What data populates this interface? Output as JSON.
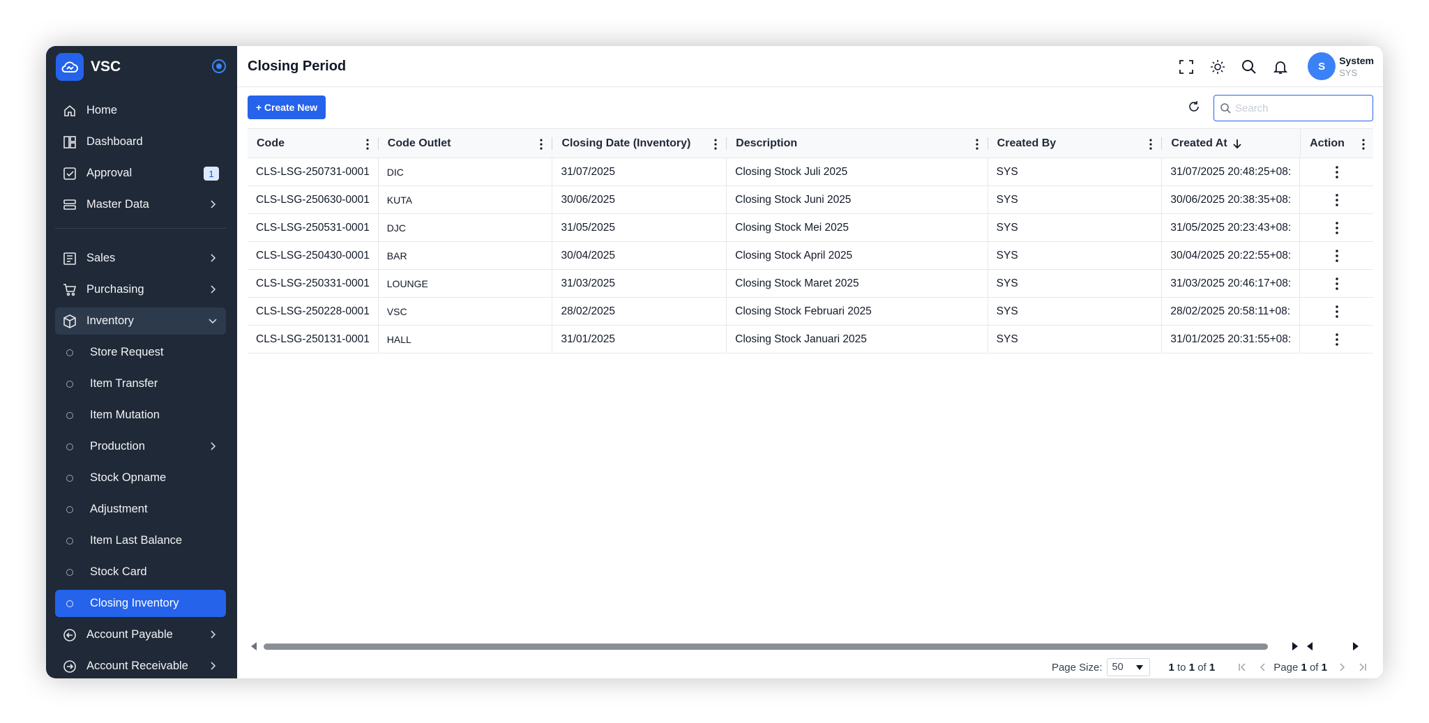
{
  "brand": {
    "name": "VSC"
  },
  "sidebar": {
    "items": [
      {
        "label": "Home",
        "icon": "home-icon"
      },
      {
        "label": "Dashboard",
        "icon": "dashboard-icon"
      },
      {
        "label": "Approval",
        "icon": "approval-icon",
        "badge": "1"
      },
      {
        "label": "Master Data",
        "icon": "database-icon"
      },
      {
        "label": "Sales",
        "icon": "sales-icon"
      },
      {
        "label": "Purchasing",
        "icon": "cart-icon"
      },
      {
        "label": "Inventory",
        "icon": "box-icon"
      },
      {
        "label": "Store Request"
      },
      {
        "label": "Item Transfer"
      },
      {
        "label": "Item Mutation"
      },
      {
        "label": "Production"
      },
      {
        "label": "Stock Opname"
      },
      {
        "label": "Adjustment"
      },
      {
        "label": "Item Last Balance"
      },
      {
        "label": "Stock Card"
      },
      {
        "label": "Closing Inventory"
      },
      {
        "label": "Account Payable",
        "icon": "arrow-left-circle-icon"
      },
      {
        "label": "Account Receivable",
        "icon": "arrow-right-circle-icon"
      }
    ]
  },
  "header": {
    "title": "Closing Period",
    "user": {
      "initial": "S",
      "name": "System",
      "code": "SYS"
    }
  },
  "toolbar": {
    "create_label": "+ Create New",
    "search_placeholder": "Search"
  },
  "table": {
    "columns": [
      "Code",
      "Code Outlet",
      "Closing Date (Inventory)",
      "Description",
      "Created By",
      "Created At",
      "Action"
    ],
    "rows": [
      [
        "CLS-LSG-250731-0001",
        "DIC",
        "31/07/2025",
        "Closing Stock Juli 2025",
        "SYS",
        "31/07/2025  20:48:25+08:"
      ],
      [
        "CLS-LSG-250630-0001",
        "KUTA",
        "30/06/2025",
        "Closing Stock Juni 2025",
        "SYS",
        "30/06/2025  20:38:35+08:"
      ],
      [
        "CLS-LSG-250531-0001",
        "DJC",
        "31/05/2025",
        "Closing Stock Mei 2025",
        "SYS",
        "31/05/2025  20:23:43+08:"
      ],
      [
        "CLS-LSG-250430-0001",
        "BAR",
        "30/04/2025",
        "Closing Stock April 2025",
        "SYS",
        "30/04/2025  20:22:55+08:"
      ],
      [
        "CLS-LSG-250331-0001",
        "LOUNGE",
        "31/03/2025",
        "Closing Stock Maret 2025",
        "SYS",
        "31/03/2025  20:46:17+08:"
      ],
      [
        "CLS-LSG-250228-0001",
        "VSC",
        "28/02/2025",
        "Closing Stock Februari 2025",
        "SYS",
        "28/02/2025  20:58:11+08:"
      ],
      [
        "CLS-LSG-250131-0001",
        "HALL",
        "31/01/2025",
        "Closing Stock Januari 2025",
        "SYS",
        "31/01/2025  20:31:55+08:"
      ]
    ]
  },
  "footer": {
    "page_size_label": "Page Size:",
    "page_size_value": "50",
    "range_from": "1",
    "range_to": "1",
    "range_total": "1",
    "page_current": "1",
    "page_total": "1"
  },
  "colors": {
    "accent": "#2563eb",
    "sidebar_bg": "#1f2937"
  }
}
